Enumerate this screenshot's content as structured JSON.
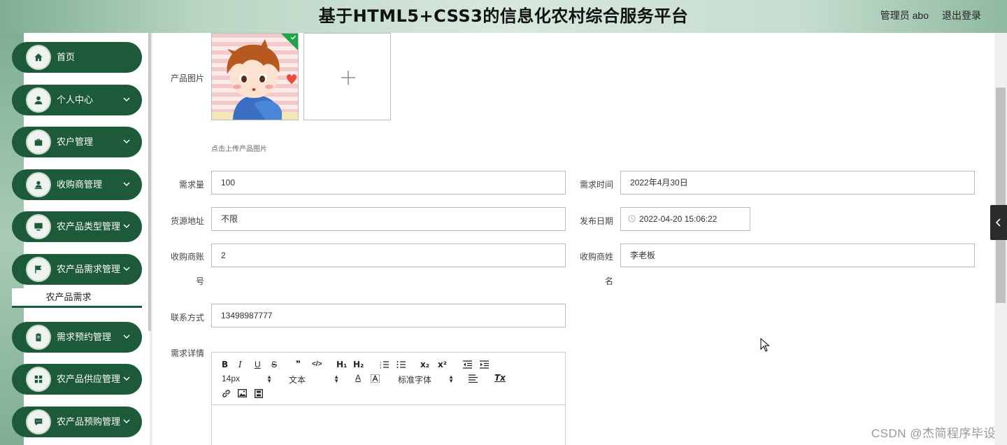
{
  "header": {
    "title": "基于HTML5+CSS3的信息化农村综合服务平台",
    "user": "管理员 abo",
    "logout": "退出登录"
  },
  "sidebar": {
    "items": [
      {
        "label": "首页",
        "icon": "home-icon",
        "chevron": false
      },
      {
        "label": "个人中心",
        "icon": "user-icon",
        "chevron": true
      },
      {
        "label": "农户管理",
        "icon": "briefcase-icon",
        "chevron": true
      },
      {
        "label": "收购商管理",
        "icon": "person-card-icon",
        "chevron": true
      },
      {
        "label": "农产品类型管理",
        "icon": "monitor-icon",
        "chevron": true
      },
      {
        "label": "农产品需求管理",
        "icon": "flag-icon",
        "chevron": true
      },
      {
        "label": "需求预约管理",
        "icon": "clipboard-icon",
        "chevron": true
      },
      {
        "label": "农产品供应管理",
        "icon": "grid-icon",
        "chevron": true
      },
      {
        "label": "农产品预购管理",
        "icon": "chat-icon",
        "chevron": true
      }
    ],
    "sub_item": "农产品需求"
  },
  "form": {
    "image_label": "产品图片",
    "upload_hint": "点击上传产品图片",
    "demand_qty_label": "需求量",
    "demand_qty": "100",
    "demand_time_label": "需求时间",
    "demand_time": "2022年4月30日",
    "source_label": "货源地址",
    "source": "不限",
    "publish_date_label": "发布日期",
    "publish_date": "2022-04-20 15:06:22",
    "buyer_account_label_1": "收购商账",
    "buyer_account_label_2": "号",
    "buyer_account": "2",
    "buyer_name_label_1": "收购商姓",
    "buyer_name_label_2": "名",
    "buyer_name": "李老板",
    "contact_label": "联系方式",
    "contact": "13498987777",
    "details_label": "需求详情"
  },
  "editor": {
    "font_size": "14px",
    "text_type": "文本",
    "font_family": "标准字体",
    "buttons": {
      "bold": "B",
      "italic": "I",
      "underline": "U",
      "strike": "S",
      "quote": "❞",
      "code": "</>",
      "h1": "H₁",
      "h2": "H₂",
      "sub": "x₂",
      "sup": "x²",
      "color": "A",
      "clear": "Tx"
    }
  },
  "watermark": "CSDN @杰简程序毕设",
  "colors": {
    "accent": "#1c5a3a",
    "check": "#21a34a"
  }
}
